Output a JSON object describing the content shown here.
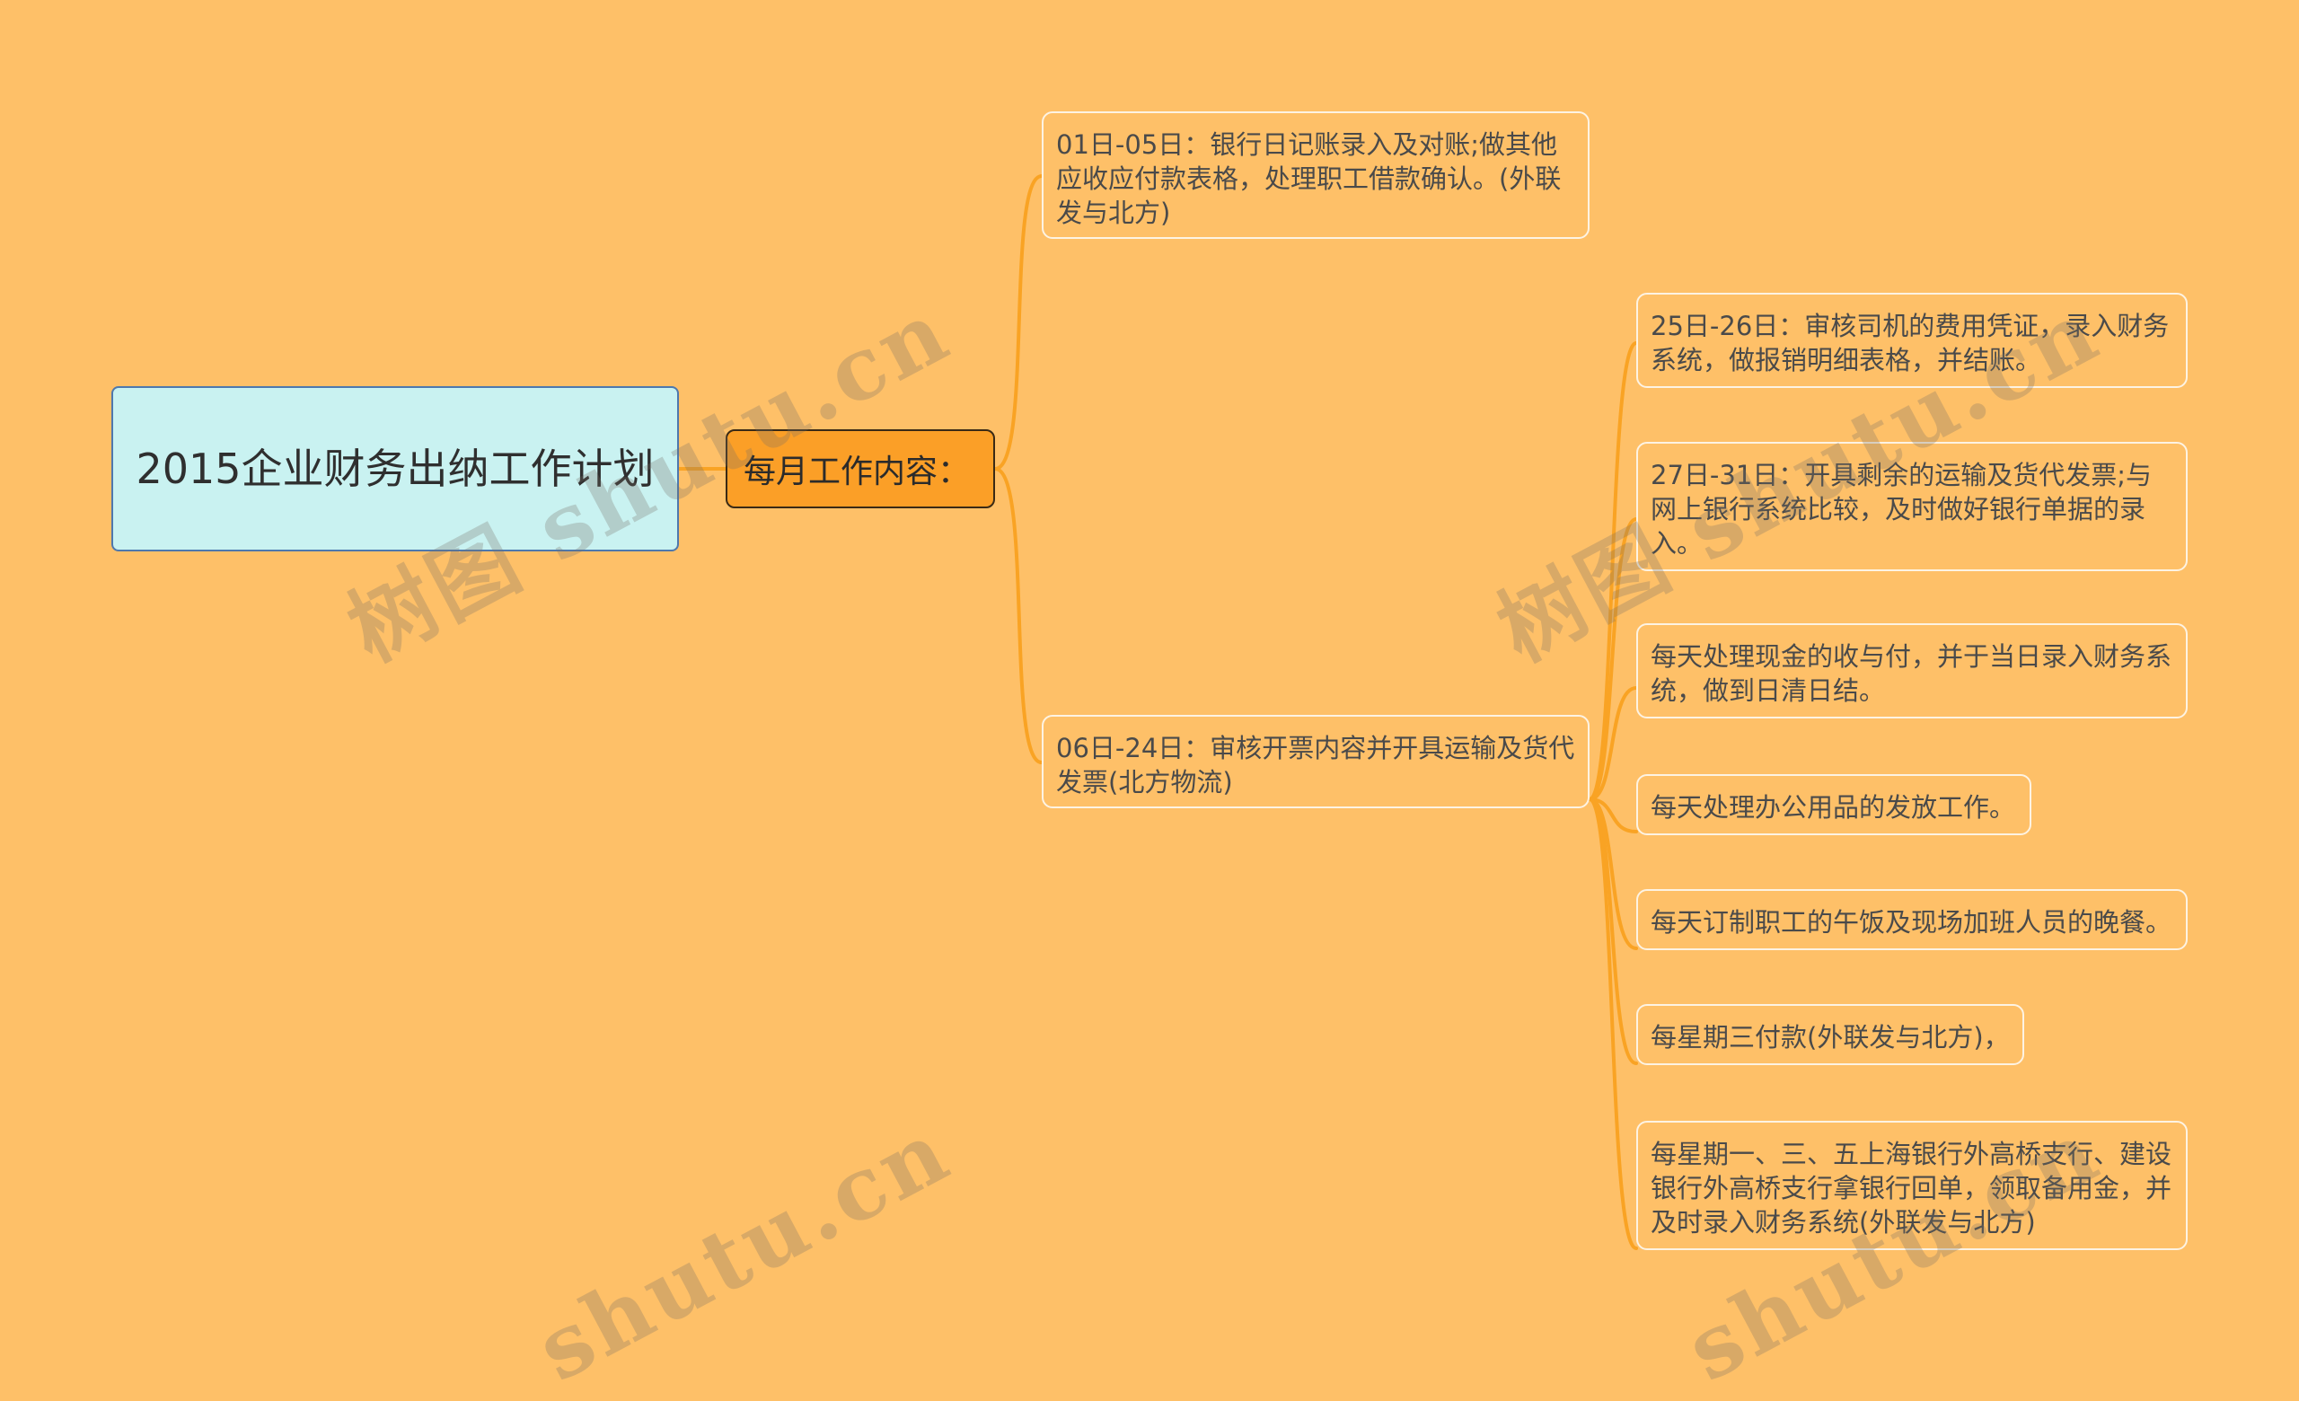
{
  "root": {
    "title": "2015企业财务出纳工作计划"
  },
  "branch": {
    "label": "每月工作内容："
  },
  "level2": [
    {
      "text": "01日-05日：银行日记账录入及对账;做其他应收应付款表格，处理职工借款确认。(外联发与北方)"
    },
    {
      "text": "06日-24日：审核开票内容并开具运输及货代发票(北方物流)"
    }
  ],
  "level3": [
    {
      "text": "25日-26日：审核司机的费用凭证，录入财务系统，做报销明细表格，并结账。"
    },
    {
      "text": "27日-31日：开具剩余的运输及货代发票;与网上银行系统比较，及时做好银行单据的录入。"
    },
    {
      "text": "每天处理现金的收与付，并于当日录入财务系统，做到日清日结。"
    },
    {
      "text": "每天处理办公用品的发放工作。"
    },
    {
      "text": "每天订制职工的午饭及现场加班人员的晚餐。"
    },
    {
      "text": "每星期三付款(外联发与北方)，"
    },
    {
      "text": "每星期一、三、五上海银行外高桥支行、建设银行外高桥支行拿银行回单，领取备用金，并及时录入财务系统(外联发与北方)"
    }
  ],
  "watermarks": [
    "树图 shutu.cn",
    "树图 shutu.cn",
    "shutu.cn",
    "shutu.cn"
  ],
  "colors": {
    "background": "#fec068",
    "root_fill": "#c9f2f1",
    "root_border": "#4e78ad",
    "branch_fill": "#fb9f27",
    "connector": "#f9a324",
    "leaf_border": "#fdf3e3"
  }
}
